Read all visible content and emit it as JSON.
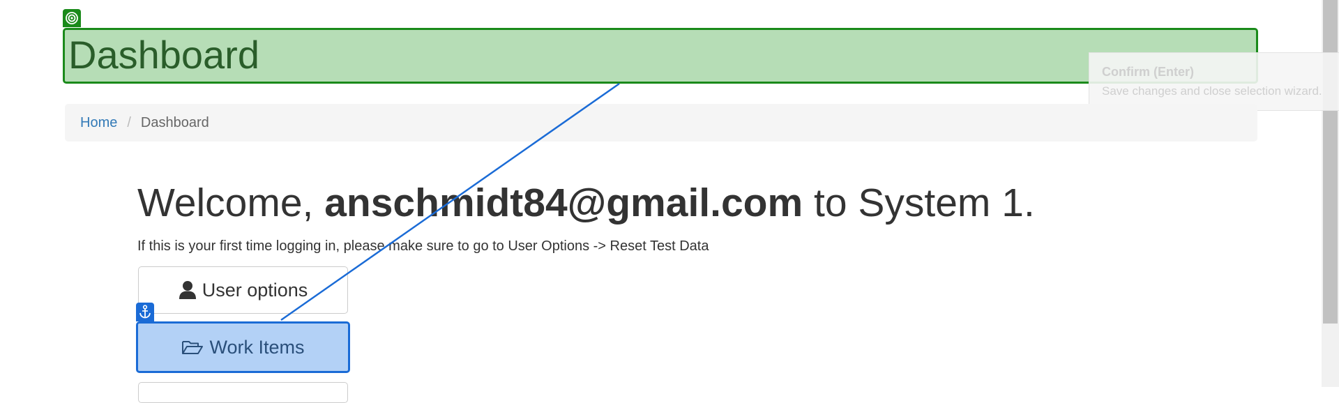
{
  "header": {
    "title": "Dashboard"
  },
  "tooltip": {
    "title": "Confirm (Enter)",
    "description": "Save changes and close selection wizard."
  },
  "breadcrumb": {
    "items": [
      {
        "label": "Home"
      },
      {
        "label": "Dashboard"
      }
    ],
    "separator": "/"
  },
  "welcome": {
    "prefix": "Welcome, ",
    "user": "anschmidt84@gmail.com",
    "suffix": " to System 1."
  },
  "notice": "If this is your first time logging in, please make sure to go to User Options -> Reset Test Data",
  "buttons": {
    "user_options": "User options",
    "work_items": "Work Items"
  },
  "icons": {
    "target": "target-icon",
    "anchor": "anchor-icon",
    "user": "user-icon",
    "folder": "folder-open-icon"
  },
  "colors": {
    "target_highlight_fill": "#b6ddb6",
    "target_highlight_border": "#1a8a1a",
    "anchor_highlight_fill": "#b3d1f6",
    "anchor_highlight_border": "#1a6bd6",
    "link": "#337ab7"
  }
}
